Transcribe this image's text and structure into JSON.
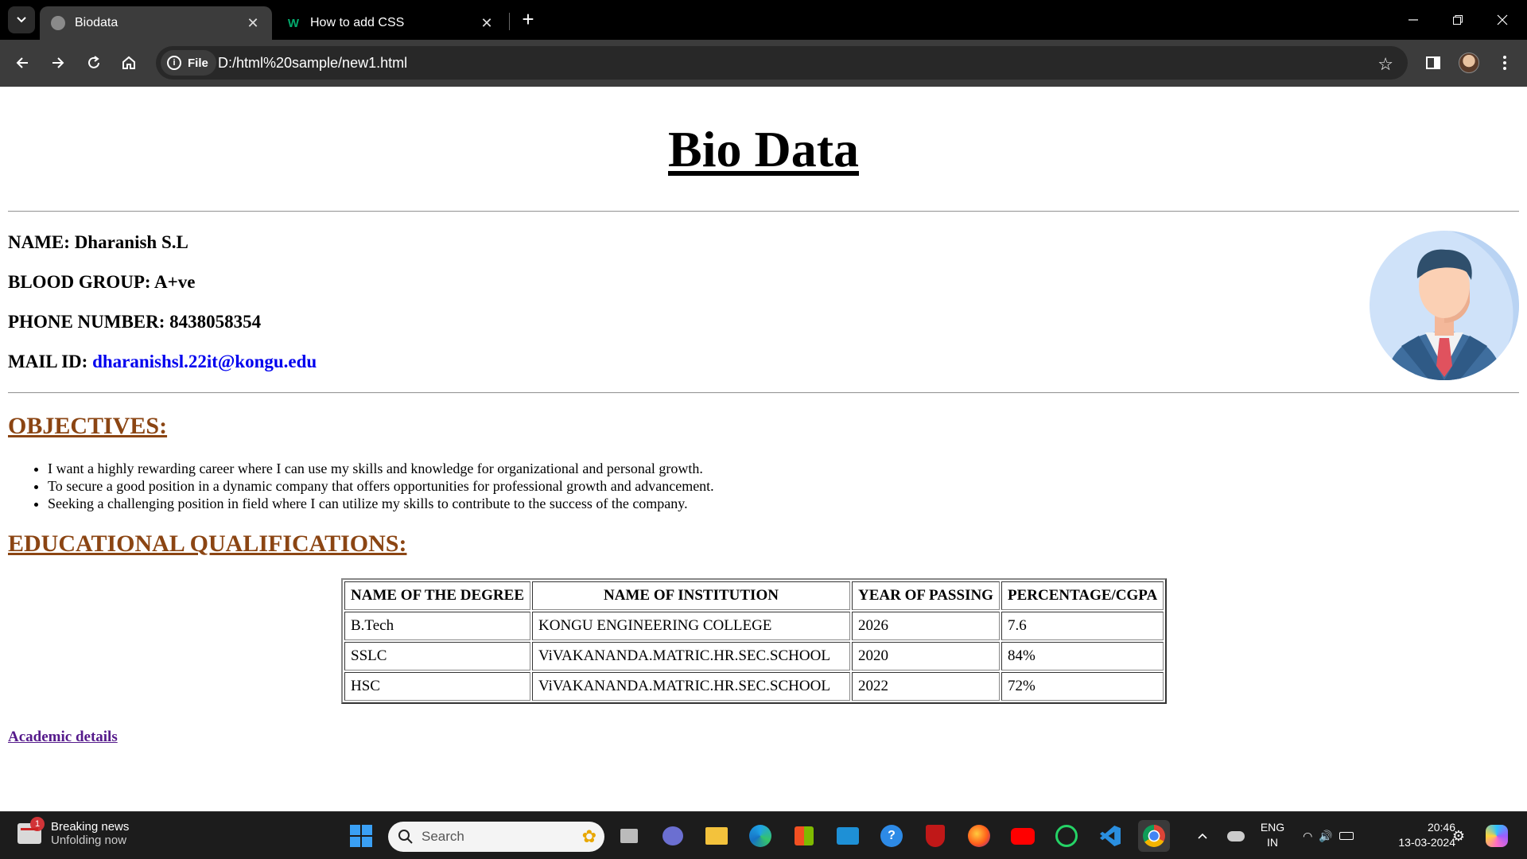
{
  "browser": {
    "tabs": [
      {
        "title": "Biodata",
        "active": true,
        "favicon": "globe-icon"
      },
      {
        "title": "How to add CSS",
        "active": false,
        "favicon": "w3schools-icon"
      }
    ],
    "address": {
      "chip_label": "File",
      "url": "D:/html%20sample/new1.html"
    }
  },
  "page": {
    "title": "Bio Data",
    "name_label": "NAME:",
    "name_value": "Dharanish S.L",
    "blood_label": "BLOOD GROUP:",
    "blood_value": "A+ve",
    "phone_label": "PHONE NUMBER:",
    "phone_value": "8438058354",
    "mail_label": "MAIL ID:",
    "mail_value": "dharanishsl.22it@kongu.edu",
    "objectives_heading": "OBJECTIVES:",
    "objectives": [
      "I want a highly rewarding career where I can use my skills and knowledge for organizational and personal growth.",
      "To secure a good position in a dynamic company that offers opportunities for professional growth and advancement.",
      "Seeking a challenging position in field where I can utilize my skills to contribute to the success of the company."
    ],
    "education_heading": "EDUCATIONAL QUALIFICATIONS:",
    "table": {
      "headers": [
        "NAME OF THE DEGREE",
        "NAME OF INSTITUTION",
        "YEAR OF PASSING",
        "PERCENTAGE/CGPA"
      ],
      "rows": [
        [
          "B.Tech",
          "KONGU ENGINEERING COLLEGE",
          "2026",
          "7.6"
        ],
        [
          "SSLC",
          "ViVAKANANDA.MATRIC.HR.SEC.SCHOOL",
          "2020",
          "84%"
        ],
        [
          "HSC",
          "ViVAKANANDA.MATRIC.HR.SEC.SCHOOL",
          "2022",
          "72%"
        ]
      ]
    },
    "academic_link": "Academic details"
  },
  "taskbar": {
    "news_title": "Breaking news",
    "news_sub": "Unfolding now",
    "news_badge": "1",
    "search_placeholder": "Search",
    "lang_1": "ENG",
    "lang_2": "IN",
    "time": "20:46",
    "date": "13-03-2024"
  },
  "colors": {
    "heading": "#8b4513",
    "link": "#0000ee",
    "visited_link": "#551a8b"
  }
}
